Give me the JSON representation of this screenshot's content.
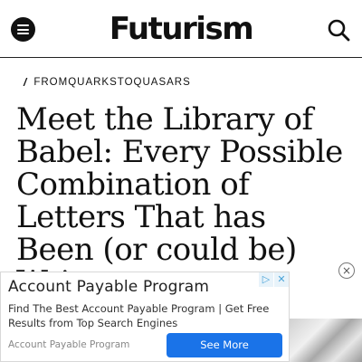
{
  "header": {
    "logo_text": "Futurism",
    "menu_icon": "hamburger-menu-icon",
    "search_icon": "search-icon"
  },
  "article": {
    "breadcrumb_mark": "/",
    "section": "FROMQUARKSTOQUASARS",
    "headline": "Meet the Library of Babel: Every Possible Combination of Letters That has Been (or could be) Written"
  },
  "ad": {
    "title": "Account Payable Program",
    "description": "Find The Best Account Payable Program | Get Free Results from Top Search Engines",
    "advertiser": "Account Payable Program",
    "cta_label": "See More",
    "adchoices_glyph": "▷",
    "dismiss_glyph": "✕",
    "close_glyph": "×",
    "cta_color": "#1a73e8"
  }
}
